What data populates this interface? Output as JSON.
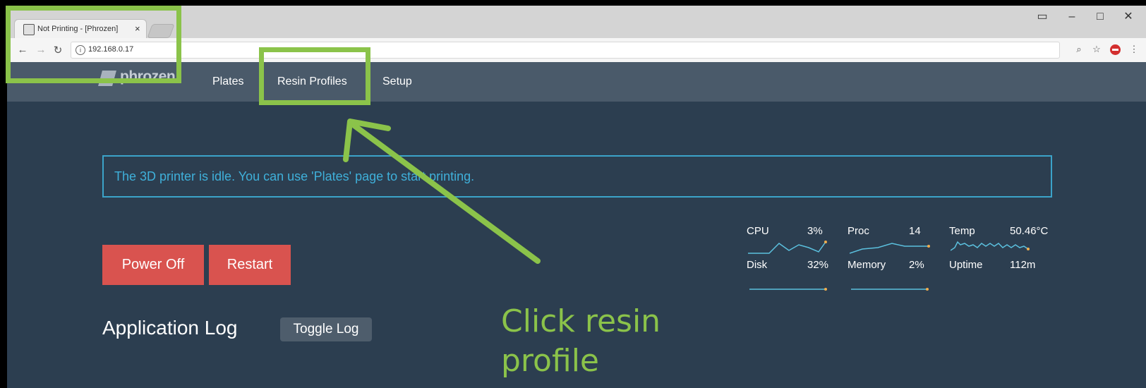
{
  "browser": {
    "tab_title": "Not Printing - [Phrozen]",
    "url": "192.168.0.17",
    "window_controls": {
      "minimize": "–",
      "maximize": "□",
      "close": "✕"
    }
  },
  "nav": {
    "logo": "phrozen",
    "links": [
      "Plates",
      "Resin Profiles",
      "Setup"
    ]
  },
  "alert": {
    "message": "The 3D printer is idle. You can use 'Plates' page to start printing."
  },
  "buttons": {
    "power_off": "Power Off",
    "restart": "Restart"
  },
  "log": {
    "title": "Application Log",
    "toggle": "Toggle Log"
  },
  "stats": {
    "cpu_label": "CPU",
    "cpu_value": "3%",
    "proc_label": "Proc",
    "proc_value": "14",
    "temp_label": "Temp",
    "temp_value": "50.46°C",
    "disk_label": "Disk",
    "disk_value": "32%",
    "memory_label": "Memory",
    "memory_value": "2%",
    "uptime_label": "Uptime",
    "uptime_value": "112m"
  },
  "annotation": {
    "caption_line1": "Click resin",
    "caption_line2": "profile",
    "color": "#8bc34a"
  },
  "colors": {
    "nav_bg": "#4a5a6a",
    "page_bg": "#2c3e50",
    "alert_border": "#3ba3c9",
    "danger": "#d9534f",
    "spark_line": "#5bc0de",
    "spark_dot": "#f0ad4e"
  }
}
